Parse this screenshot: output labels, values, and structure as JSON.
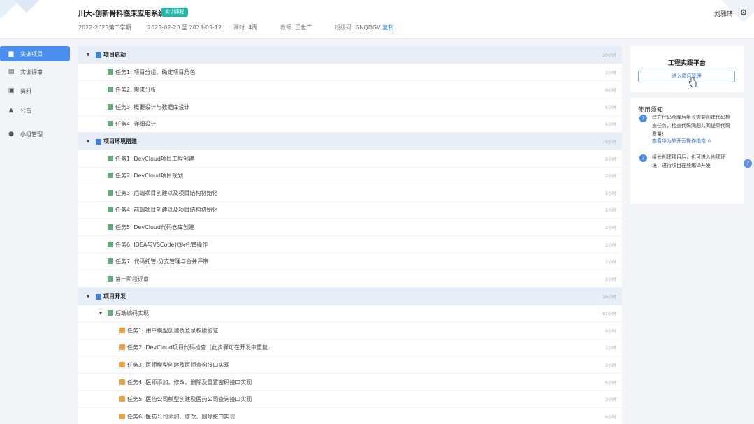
{
  "header": {
    "title": "川大-创新骨科临床应用系统",
    "badge": "实训课程",
    "semester": "2022-2023第二学期",
    "date_range": "2023-02-20 至 2023-03-12",
    "duration_label": "课时:",
    "duration_value": "4周",
    "teacher_label": "教师:",
    "teacher_value": "王世广",
    "class_code_label": "班级码:",
    "class_code_value": "GNQDGV",
    "copy_label": "复制",
    "username": "刘雅琦"
  },
  "sidebar": {
    "items": [
      {
        "label": "实训项目",
        "icon": "folder-icon"
      },
      {
        "label": "实训评审",
        "icon": "review-icon"
      },
      {
        "label": "资料",
        "icon": "files-icon"
      },
      {
        "label": "公告",
        "icon": "bell-icon"
      },
      {
        "label": "小组管理",
        "icon": "group-icon"
      }
    ]
  },
  "tasks": {
    "s1": {
      "label": "项目启动",
      "hours": "20小时"
    },
    "s1_items": [
      {
        "label": "任务1:  项目分组、确定项目角色",
        "hours": "2小时"
      },
      {
        "label": "任务2:  需求分析",
        "hours": "6小时"
      },
      {
        "label": "任务3:  概要设计与数据库设计",
        "hours": "6小时"
      },
      {
        "label": "任务4:  详细设计",
        "hours": "6小时"
      }
    ],
    "s2": {
      "label": "项目环境搭建",
      "hours": "16小时"
    },
    "s2_items": [
      {
        "label": "任务1:  DevCloud项目工程创建",
        "hours": "2小时"
      },
      {
        "label": "任务2:  DevCloud项目规划",
        "hours": "2小时"
      },
      {
        "label": "任务3:  后端项目创建以及项目结构初始化",
        "hours": "2小时"
      },
      {
        "label": "任务4:  前端项目创建以及项目结构初始化",
        "hours": "2小时"
      },
      {
        "label": "任务5:  DevCloud代码仓库创建",
        "hours": "2小时"
      },
      {
        "label": "任务6:  IDEA与VSCode代码托管操作",
        "hours": "2小时"
      },
      {
        "label": "任务7:  代码托管-分支管理与合并评审",
        "hours": "2小时"
      },
      {
        "label": "第一阶段评审",
        "hours": "2小时"
      }
    ],
    "s3": {
      "label": "项目开发",
      "hours": "26小时"
    },
    "s3_sub": {
      "label": "后端编码实现",
      "hours": "82小时"
    },
    "s3_items": [
      {
        "label": "任务1:  用户模型创建及登录权限验证",
        "hours": "6小时"
      },
      {
        "label": "任务2:  DevCloud项目代码检查（此步骤可在开发中重复...",
        "hours": "1小时"
      },
      {
        "label": "任务3:  医师模型创建及医师查询接口实现",
        "hours": "3小时"
      },
      {
        "label": "任务4:  医师添加、修改、删除及重置密码接口实现",
        "hours": "6小时"
      },
      {
        "label": "任务5:  医药公司模型创建及医药公司查询接口实现",
        "hours": "3小时"
      },
      {
        "label": "任务6:  医药公司添加、修改、删除接口实现",
        "hours": "6小时"
      }
    ]
  },
  "right": {
    "platform_title": "工程实践平台",
    "enter_button": "进入项目管理",
    "notice_title": "使用须知",
    "notice1": "建立代码仓库后组长需要创建代码检查任务，检查代码同题共同提高代码质量!",
    "guide_link": "查看华为软开云操作指南",
    "notice2": "组长创建项目后，也可进入他项环境，进行项目在线编译开发"
  },
  "colors": {
    "accent": "#4a8ff0",
    "badge": "#1fb8a6",
    "section_bg": "#e8eef7"
  }
}
